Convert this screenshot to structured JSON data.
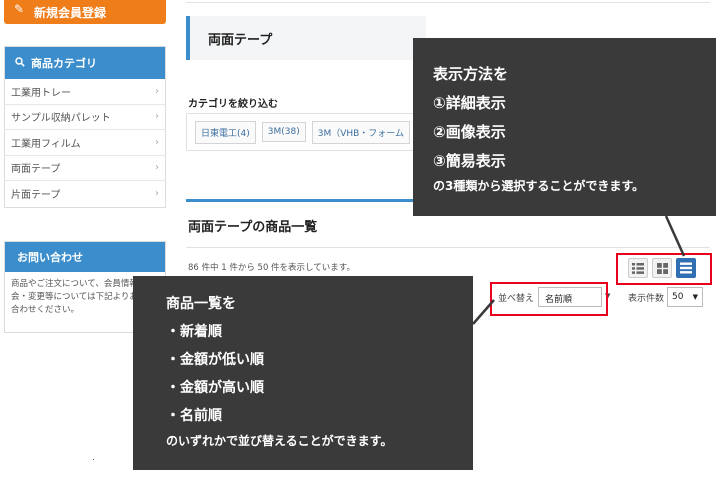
{
  "sidebar": {
    "signup_label": "新規会員登録",
    "category_heading": "商品カテゴリ",
    "categories": [
      {
        "label": "工業用トレー"
      },
      {
        "label": "サンプル収納パレット"
      },
      {
        "label": "工業用フィルム"
      },
      {
        "label": "両面テープ"
      },
      {
        "label": "片面テープ"
      }
    ],
    "chevron": "›",
    "contact_heading": "お問い合わせ",
    "contact_text": "商品やご注文について、会員情報の照会・変更等については下記よりお問い合わせください。"
  },
  "main": {
    "page_title": "両面テープ",
    "narrow_label": "カテゴリを絞り込む",
    "makers": [
      "日東電工(4)",
      "3M(38)",
      "3M（VHB・フォーム"
    ],
    "list_title": "両面テープの商品一覧",
    "count_text": "86 件中 1 件から 50 件を表示しています。",
    "view_modes": [
      "list-detail-icon",
      "grid-image-icon",
      "simple-list-icon"
    ],
    "active_view": "simple-list-icon",
    "sort_label": "並べ替え",
    "sort_value": "名前順",
    "per_page_label": "表示件数",
    "per_page_value": "50",
    "caret": "▼"
  },
  "callouts": {
    "view": {
      "lines": [
        "表示方法を",
        "①詳細表示",
        "②画像表示",
        "③簡易表示"
      ],
      "footer": "の3種類から選択することができます。"
    },
    "sort": {
      "lines": [
        "商品一覧を",
        "・新着順",
        "・金額が低い順",
        "・金額が高い順",
        "・名前順"
      ],
      "footer": "のいずれかで並び替えることができます。"
    }
  },
  "colors": {
    "accent_blue": "#3c8dcb",
    "signup_orange": "#ef7d1a",
    "highlight_red": "#e8001c",
    "callout_bg": "#3a3a3a"
  }
}
